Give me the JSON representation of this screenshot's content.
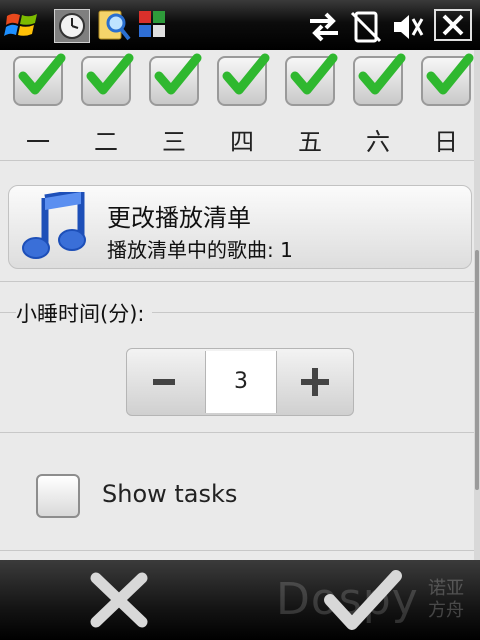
{
  "status_bar": {
    "icons": [
      "windows-start-icon",
      "clock-icon",
      "search-icon",
      "tiles-icon",
      "sync-arrows-icon",
      "no-signal-icon",
      "speaker-muted-icon",
      "close-icon"
    ]
  },
  "days": {
    "items": [
      {
        "label": "一",
        "checked": true
      },
      {
        "label": "二",
        "checked": true
      },
      {
        "label": "三",
        "checked": true
      },
      {
        "label": "四",
        "checked": true
      },
      {
        "label": "五",
        "checked": true
      },
      {
        "label": "六",
        "checked": true
      },
      {
        "label": "日",
        "checked": true
      }
    ]
  },
  "playlist": {
    "title": "更改播放清单",
    "subtitle": "播放清单中的歌曲: 1"
  },
  "snooze": {
    "label": "小睡时间(分):",
    "value": "3",
    "minus_symbol": "−",
    "plus_symbol": "+"
  },
  "tasks": {
    "label": "Show tasks",
    "checked": false
  },
  "softkeys": {
    "watermark": "Dospy",
    "watermark_cn_1": "诺亚",
    "watermark_cn_2": "方舟"
  },
  "colors": {
    "check_green": "#2fb82f",
    "note_blue": "#3a6fd8",
    "bar_dark": "#0c0c0c"
  }
}
